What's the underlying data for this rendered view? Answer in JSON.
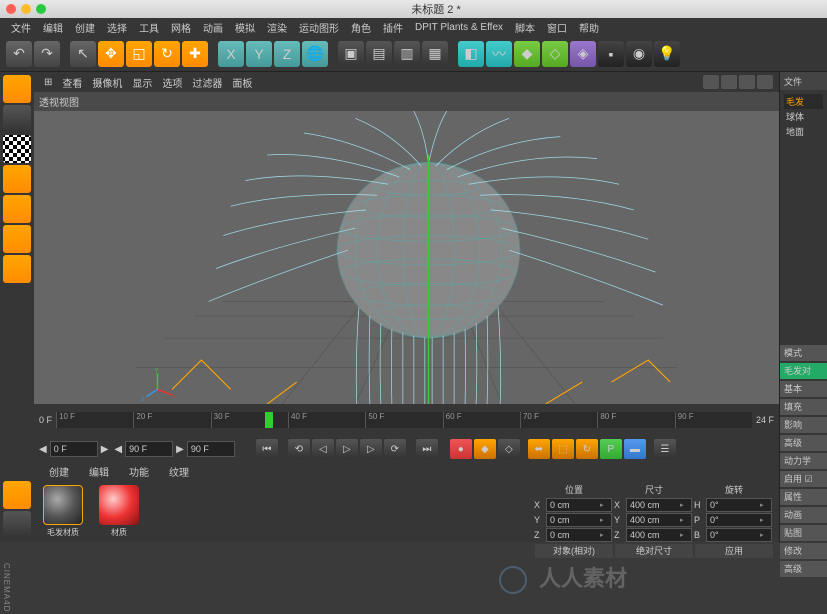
{
  "window": {
    "title": "未标题 2 *"
  },
  "menu": [
    "文件",
    "编辑",
    "创建",
    "选择",
    "工具",
    "网格",
    "动画",
    "模拟",
    "渲染",
    "运动图形",
    "角色",
    "插件",
    "DPIT Plants & Effex",
    "脚本",
    "窗口",
    "帮助"
  ],
  "viewport": {
    "menu": [
      "查看",
      "摄像机",
      "显示",
      "选项",
      "过滤器",
      "面板"
    ],
    "label": "透视视图"
  },
  "timeline": {
    "start_left": "0 F",
    "ticks": [
      "10 F",
      "20 F",
      "30 F",
      "40 F",
      "50 F",
      "60 F",
      "70 F",
      "80 F",
      "90 F"
    ],
    "end_right": "24 F"
  },
  "playback": {
    "start": "0 F",
    "current": "90 F",
    "end": "90 F"
  },
  "materials": {
    "tabs": [
      "创建",
      "编辑",
      "功能",
      "纹理"
    ],
    "items": [
      {
        "name": "毛发材质",
        "type": "gray"
      },
      {
        "name": "材质",
        "type": "red"
      }
    ]
  },
  "coords": {
    "headers": [
      "位置",
      "尺寸",
      "旋转"
    ],
    "rows": [
      {
        "axis": "X",
        "pos": "0 cm",
        "size_label": "X",
        "size": "400 cm",
        "rot_label": "H",
        "rot": "0°"
      },
      {
        "axis": "Y",
        "pos": "0 cm",
        "size_label": "Y",
        "size": "400 cm",
        "rot_label": "P",
        "rot": "0°"
      },
      {
        "axis": "Z",
        "pos": "0 cm",
        "size_label": "Z",
        "size": "400 cm",
        "rot_label": "B",
        "rot": "0°"
      }
    ],
    "buttons": [
      "对象(相对)",
      "绝对尺寸",
      "应用"
    ]
  },
  "objects": {
    "header": "文件",
    "tree": [
      {
        "name": "毛发",
        "active": true
      },
      {
        "name": "球体",
        "active": false
      },
      {
        "name": "地面",
        "active": false
      }
    ]
  },
  "right_sections": {
    "mode": "模式",
    "hair": "毛发对",
    "tabs": [
      "基本",
      "填充",
      "影响",
      "高级"
    ],
    "dynamics": "动力学",
    "enable": "启用",
    "props": [
      "属性",
      "动画",
      "贴图",
      "修改",
      "高级"
    ]
  },
  "app_label": "CINEMA4D",
  "watermark": "人人素材"
}
